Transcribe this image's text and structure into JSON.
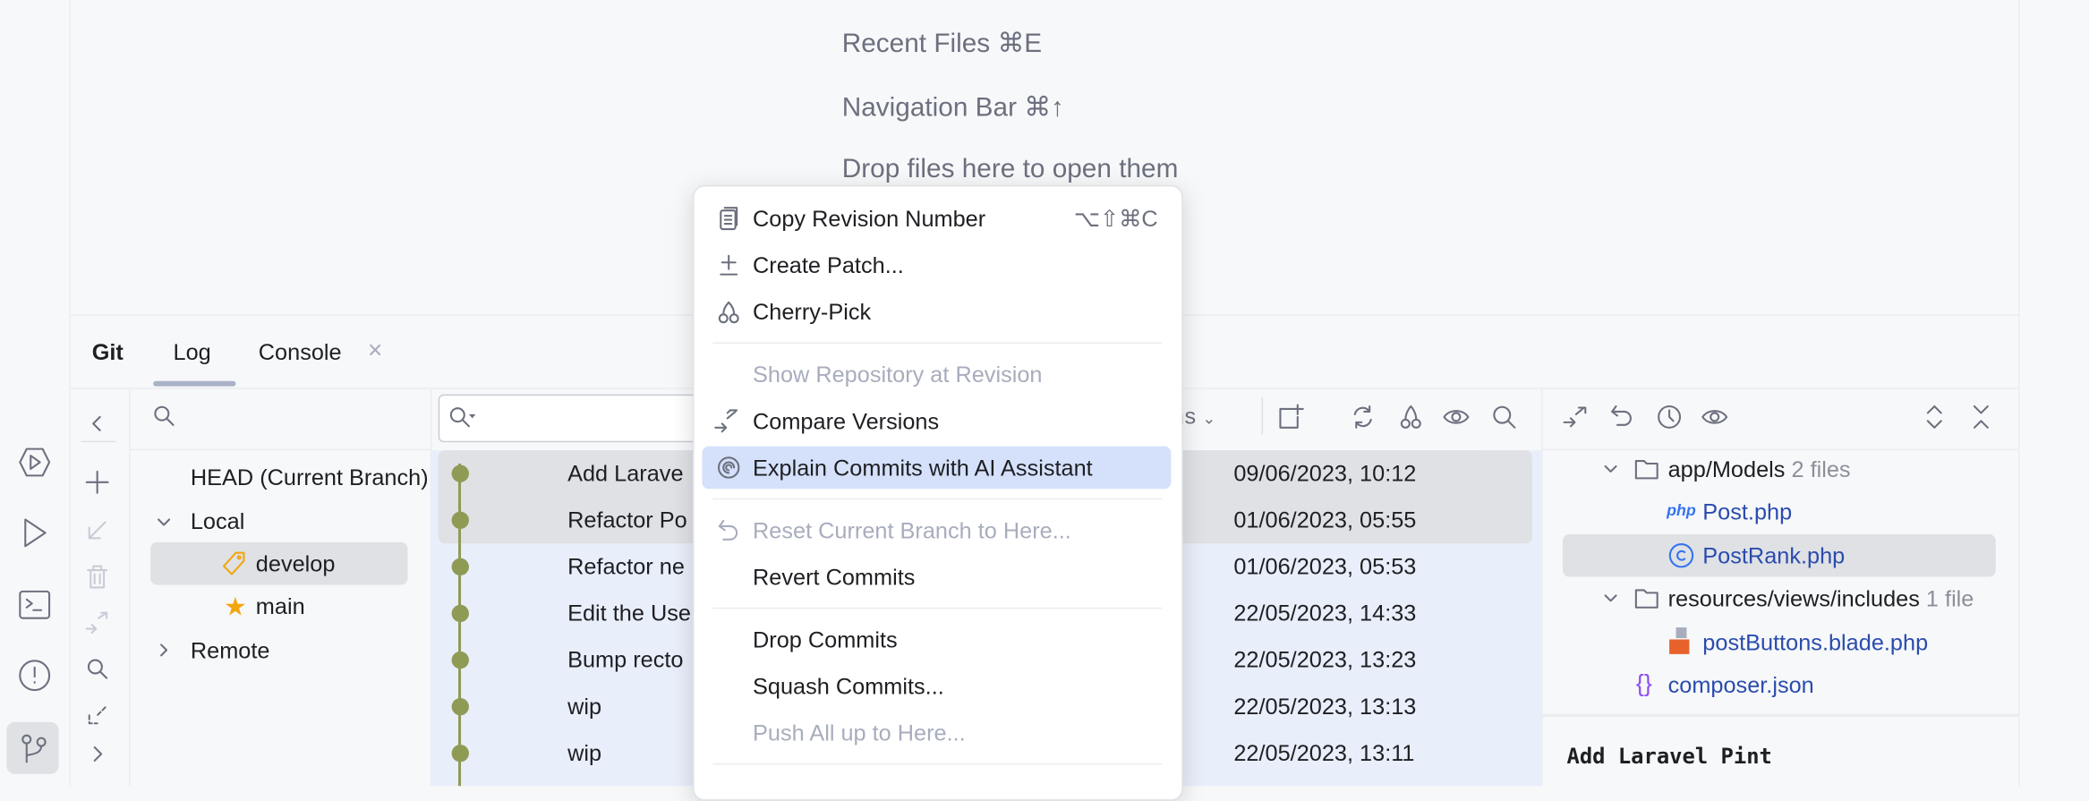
{
  "editor_hints": [
    "Recent Files ⌘E",
    "Navigation Bar ⌘↑",
    "Drop files here to open them"
  ],
  "tool_window": {
    "title": "Git",
    "tabs": [
      {
        "label": "Log",
        "active": true
      },
      {
        "label": "Console",
        "closable": true
      }
    ],
    "close_glyph": "×"
  },
  "left_strip_icons": [
    "services-icon",
    "run-icon",
    "terminal-icon",
    "problems-icon",
    "git-icon"
  ],
  "branches": {
    "head": "HEAD (Current Branch)",
    "local": "Local",
    "local_branches": [
      {
        "name": "develop",
        "icon": "tag-icon",
        "selected": true
      },
      {
        "name": "main",
        "icon": "star-icon"
      }
    ],
    "remote": "Remote"
  },
  "log": {
    "filter_label": "ths",
    "commits": [
      {
        "message": "Add Larave",
        "date": "09/06/2023, 10:12",
        "selected": true
      },
      {
        "message": "Refactor Po",
        "date": "01/06/2023, 05:55",
        "selected": true
      },
      {
        "message": "Refactor ne",
        "date": "01/06/2023, 05:53"
      },
      {
        "message": "Edit the Use",
        "date": "22/05/2023, 14:33"
      },
      {
        "message": "Bump recto",
        "date": "22/05/2023, 13:23"
      },
      {
        "message": "wip",
        "date": "22/05/2023, 13:13"
      },
      {
        "message": "wip",
        "date": "22/05/2023, 13:11"
      }
    ],
    "graph_color": "#8f9a55"
  },
  "context_menu": {
    "items": [
      {
        "label": "Copy Revision Number",
        "shortcut": "⌥⇧⌘C",
        "icon": "copy-icon"
      },
      {
        "label": "Create Patch...",
        "icon": "patch-icon"
      },
      {
        "label": "Cherry-Pick",
        "icon": "cherry-icon"
      },
      {
        "label": "Show Repository at Revision",
        "disabled": true
      },
      {
        "label": "Compare Versions",
        "icon": "compare-icon"
      },
      {
        "label": "Explain Commits with AI Assistant",
        "icon": "ai-assistant-icon",
        "highlighted": true
      },
      {
        "label": "Reset Current Branch to Here...",
        "icon": "undo-icon",
        "disabled": true
      },
      {
        "label": "Revert Commits"
      },
      {
        "label": "Drop Commits"
      },
      {
        "label": "Squash Commits..."
      },
      {
        "label": "Push All up to Here...",
        "disabled": true
      }
    ]
  },
  "changes": {
    "tree": [
      {
        "name": "app/Models",
        "count": "2 files",
        "type": "folder"
      },
      {
        "name": "Post.php",
        "type": "php",
        "icon_text": "php"
      },
      {
        "name": "PostRank.php",
        "type": "class",
        "selected": true
      },
      {
        "name": "resources/views/includes",
        "count": "1 file",
        "type": "folder"
      },
      {
        "name": "postButtons.blade.php",
        "type": "blade"
      },
      {
        "name": "composer.json",
        "type": "json",
        "icon_text": "{}"
      }
    ],
    "commit_title": "Add Laravel Pint"
  },
  "colors": {
    "accent": "#3574f0",
    "selection": "#dfe1e5",
    "highlight": "#d5e1fb",
    "row_blue": "#e8eefa",
    "file_link": "#2a4cad"
  }
}
